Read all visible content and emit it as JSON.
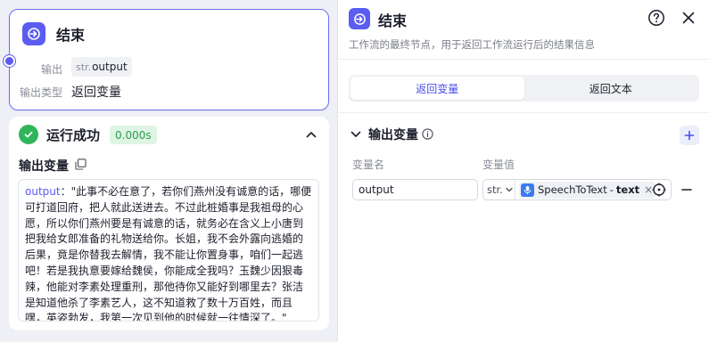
{
  "node": {
    "title": "结束",
    "output_label": "输出",
    "output_type_prefix": "str.",
    "output_name": "output",
    "type_label": "输出类型",
    "type_value": "返回变量"
  },
  "result": {
    "status": "运行成功",
    "time": "0.000s",
    "var_title": "输出变量",
    "output_key": "output",
    "output_text": "：\"此事不必在意了，若你们燕州没有诚意的话，哪便可打道回府，把人就此送进去。不过此桩婚事是我祖母的心愿，所以你们燕州要是有诚意的话，就务必在含义上小唐到把我给女郎准备的礼物送给你。长姐，我不会外露向逃婚的后果，竟是你替我去解情，我不能让你置身事，咱们一起逃吧！若是我执意要嫁给魏侯，你能成全我吗？玉魏少因狠毒辣，他能对李素处理重刑，那他待你又能好到哪里去？张洁是知道他杀了李素艺人，这不知道救了数十万百姓，而且嘿，英姿勃发，我第一次见到他的时候就一往情深了。\""
  },
  "panel": {
    "title": "结束",
    "description": "工作流的最终节点，用于返回工作流运行后的结果信息",
    "tabs": [
      {
        "label": "返回变量",
        "active": true
      },
      {
        "label": "返回文本",
        "active": false
      }
    ],
    "section_title": "输出变量",
    "col_name": "变量名",
    "col_value": "变量值",
    "var_name": "output",
    "var_type": "str.",
    "ref_node": "SpeechToText",
    "ref_sep": "-",
    "ref_field": "text",
    "ref_remove": "×"
  },
  "colors": {
    "accent": "#5b5cf0",
    "success": "#2fb55a",
    "success_bg": "#dff5e4"
  },
  "icons": [
    "end-node-icon",
    "success-check-icon",
    "chevron-up-icon",
    "copy-icon",
    "help-icon",
    "close-icon",
    "chevron-down-icon",
    "info-icon",
    "plus-icon",
    "speech-to-text-icon",
    "target-icon",
    "minus-icon"
  ]
}
